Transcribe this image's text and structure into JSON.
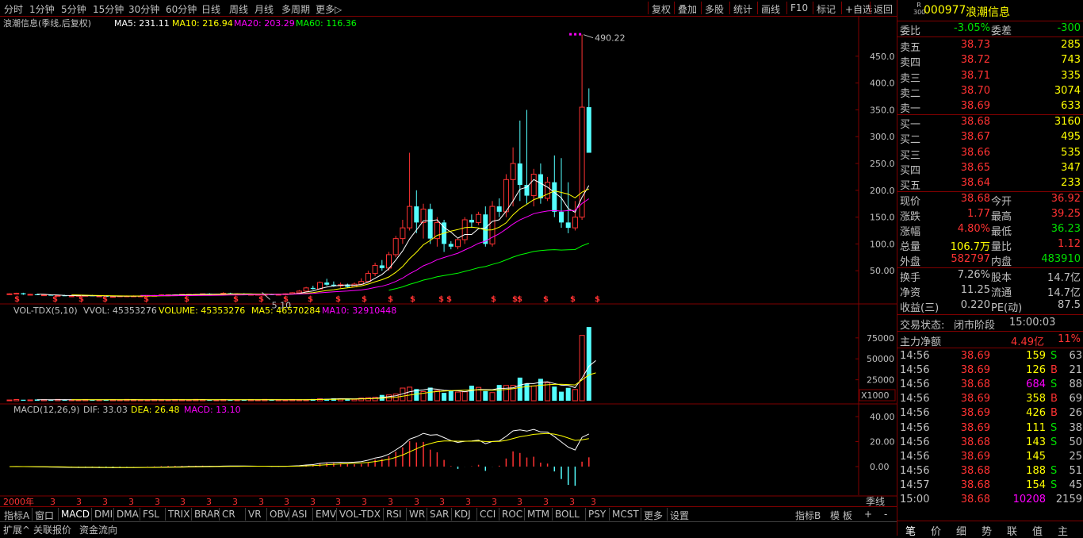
{
  "topbar": {
    "periods": [
      "分时",
      "1分钟",
      "5分钟",
      "15分钟",
      "30分钟",
      "60分钟",
      "日线",
      "周线",
      "月线",
      "多周期",
      "更多▷"
    ],
    "right_buttons": [
      "复权",
      "叠加",
      "多股",
      "统计",
      "画线",
      "F10",
      "标记",
      "+自选",
      "返回"
    ]
  },
  "main_chart": {
    "title": "浪潮信息(季线,后复权)",
    "ma5": "MA5: 231.11",
    "ma10": "MA10: 216.94",
    "ma20": "MA20: 203.29",
    "ma60": "MA60: 116.36",
    "high_label": "490.22",
    "low_label": "5.10",
    "y_ticks": [
      "450.0",
      "400.0",
      "350.0",
      "300.0",
      "250.0",
      "200.0",
      "150.0",
      "100.0",
      "50.00"
    ]
  },
  "volume_chart": {
    "title": "VOL-TDX(5,10)",
    "vvol": "VVOL: 45353276",
    "volume": "VOLUME: 45353276",
    "ma5": "MA5: 46570284",
    "ma10": "MA10: 32910448",
    "y_ticks": [
      "75000",
      "50000",
      "25000"
    ],
    "unit": "X1000"
  },
  "macd_chart": {
    "title": "MACD(12,26,9)",
    "dif": "DIF: 33.03",
    "dea": "DEA: 26.48",
    "macd": "MACD: 13.10",
    "y_ticks": [
      "40.00",
      "20.00",
      "0.00"
    ]
  },
  "date_axis": {
    "start_label": "2000年",
    "tick_label": "3",
    "period_label": "季线"
  },
  "bottom_tabs": [
    "指标A",
    "窗口",
    "MACD",
    "DMI",
    "DMA",
    "FSL",
    "TRIX",
    "BRAR",
    "CR",
    "VR",
    "OBV",
    "ASI",
    "EMV",
    "VOL-TDX",
    "RSI",
    "WR",
    "SAR",
    "KDJ",
    "CCI",
    "ROC",
    "MTM",
    "BOLL",
    "PSY",
    "MCST",
    "更多",
    "设置"
  ],
  "bottom_right": [
    "指标B",
    "模 板",
    "+",
    "-"
  ],
  "bottom_bar2": [
    "扩展^",
    "关联报价",
    "资金流向"
  ],
  "quote": {
    "badge_top": "R",
    "badge_bottom": "300",
    "code": "000977",
    "name": "浪潮信息",
    "weibi_label": "委比",
    "weibi": "-3.05%",
    "weicha_label": "委差",
    "weicha": "-300",
    "asks": [
      {
        "label": "卖五",
        "price": "38.73",
        "vol": "285"
      },
      {
        "label": "卖四",
        "price": "38.72",
        "vol": "743"
      },
      {
        "label": "卖三",
        "price": "38.71",
        "vol": "335"
      },
      {
        "label": "卖二",
        "price": "38.70",
        "vol": "3074"
      },
      {
        "label": "卖一",
        "price": "38.69",
        "vol": "633"
      }
    ],
    "bids": [
      {
        "label": "买一",
        "price": "38.68",
        "vol": "3160"
      },
      {
        "label": "买二",
        "price": "38.67",
        "vol": "495"
      },
      {
        "label": "买三",
        "price": "38.66",
        "vol": "535"
      },
      {
        "label": "买四",
        "price": "38.65",
        "vol": "347"
      },
      {
        "label": "买五",
        "price": "38.64",
        "vol": "233"
      }
    ],
    "stats": [
      {
        "l1": "现价",
        "v1": "38.68",
        "l2": "今开",
        "v2": "36.92"
      },
      {
        "l1": "涨跌",
        "v1": "1.77",
        "l2": "最高",
        "v2": "39.25"
      },
      {
        "l1": "涨幅",
        "v1": "4.80%",
        "l2": "最低",
        "v2": "36.23"
      },
      {
        "l1": "总量",
        "v1": "106.7万",
        "l2": "量比",
        "v2": "1.12"
      },
      {
        "l1": "外盘",
        "v1": "582797",
        "l2": "内盘",
        "v2": "483910"
      }
    ],
    "stats2": [
      {
        "l1": "换手",
        "v1": "7.26%",
        "l2": "股本",
        "v2": "14.7亿"
      },
      {
        "l1": "净资",
        "v1": "11.25",
        "l2": "流通",
        "v2": "14.7亿"
      },
      {
        "l1": "收益(三)",
        "v1": "0.220",
        "l2": "PE(动)",
        "v2": "87.5"
      }
    ],
    "trade_state_label": "交易状态:",
    "trade_state": "闭市阶段",
    "trade_time": "15:00:03",
    "main_net_label": "主力净额",
    "main_net": "4.49亿",
    "main_net_pct": "11%",
    "ticks": [
      {
        "t": "14:56",
        "p": "38.69",
        "v": "159",
        "bs": "S",
        "n": "63"
      },
      {
        "t": "14:56",
        "p": "38.69",
        "v": "126",
        "bs": "B",
        "n": "21"
      },
      {
        "t": "14:56",
        "p": "38.68",
        "v": "684",
        "bs": "S",
        "n": "88"
      },
      {
        "t": "14:56",
        "p": "38.69",
        "v": "358",
        "bs": "B",
        "n": "69"
      },
      {
        "t": "14:56",
        "p": "38.69",
        "v": "426",
        "bs": "B",
        "n": "26"
      },
      {
        "t": "14:56",
        "p": "38.69",
        "v": "111",
        "bs": "S",
        "n": "38"
      },
      {
        "t": "14:56",
        "p": "38.68",
        "v": "143",
        "bs": "S",
        "n": "50"
      },
      {
        "t": "14:56",
        "p": "38.69",
        "v": "145",
        "bs": "",
        "n": "25"
      },
      {
        "t": "14:56",
        "p": "38.68",
        "v": "188",
        "bs": "S",
        "n": "51"
      },
      {
        "t": "14:57",
        "p": "38.68",
        "v": "154",
        "bs": "S",
        "n": "45"
      },
      {
        "t": "15:00",
        "p": "38.68",
        "v": "10208",
        "bs": "",
        "n": "2159"
      }
    ],
    "bottom_tabs": [
      "笔",
      "价",
      "细",
      "势",
      "联",
      "值",
      "主"
    ]
  },
  "colors": {
    "up": "#ff3232",
    "down": "#54ffff",
    "ma5": "#ffffff",
    "ma10": "#ffff00",
    "ma20": "#ff00ff",
    "ma60": "#00ff00",
    "grid": "#800000",
    "axis_text": "#c0c0c0"
  },
  "chart_data": {
    "type": "candlestick",
    "title": "浪潮信息(季线,后复权)",
    "candles": [
      [
        7,
        8,
        6,
        7
      ],
      [
        7,
        9,
        6,
        8
      ],
      [
        8,
        9,
        5,
        6
      ],
      [
        6,
        7,
        5,
        6
      ],
      [
        6,
        7,
        5,
        5
      ],
      [
        5,
        6,
        4,
        5
      ],
      [
        5,
        6,
        4,
        4
      ],
      [
        4,
        5,
        3,
        4
      ],
      [
        4,
        5,
        3,
        3
      ],
      [
        3,
        4,
        3,
        3
      ],
      [
        3,
        5,
        3,
        4
      ],
      [
        4,
        5,
        3,
        4
      ],
      [
        4,
        5,
        3,
        3
      ],
      [
        3,
        4,
        2,
        3
      ],
      [
        3,
        4,
        2,
        2
      ],
      [
        2,
        3,
        2,
        2
      ],
      [
        2,
        3,
        2,
        3
      ],
      [
        3,
        4,
        2,
        3
      ],
      [
        3,
        4,
        2,
        3
      ],
      [
        3,
        4,
        3,
        3
      ],
      [
        3,
        4,
        3,
        4
      ],
      [
        4,
        5,
        3,
        4
      ],
      [
        4,
        6,
        4,
        5
      ],
      [
        5,
        6,
        4,
        5
      ],
      [
        5,
        6,
        4,
        5
      ],
      [
        5,
        6,
        4,
        6
      ],
      [
        6,
        7,
        5,
        6
      ],
      [
        6,
        7,
        5,
        6
      ],
      [
        6,
        7,
        5,
        7
      ],
      [
        7,
        8,
        5,
        6
      ],
      [
        6,
        7,
        5,
        6
      ],
      [
        6,
        10,
        5,
        8
      ],
      [
        8,
        9,
        6,
        7
      ],
      [
        7,
        8,
        6,
        7
      ],
      [
        7,
        8,
        5,
        6
      ],
      [
        6,
        7,
        5,
        6
      ],
      [
        6,
        7,
        5,
        6
      ],
      [
        6,
        7,
        5,
        6
      ],
      [
        6,
        7,
        5,
        5.1
      ],
      [
        5.1,
        7,
        5.1,
        6
      ],
      [
        6,
        8,
        6,
        7
      ],
      [
        7,
        10,
        7,
        9
      ],
      [
        9,
        14,
        8,
        12
      ],
      [
        12,
        20,
        11,
        18
      ],
      [
        18,
        22,
        15,
        16
      ],
      [
        16,
        30,
        15,
        28
      ],
      [
        28,
        35,
        22,
        24
      ],
      [
        24,
        30,
        20,
        22
      ],
      [
        22,
        28,
        18,
        24
      ],
      [
        24,
        26,
        18,
        20
      ],
      [
        20,
        28,
        19,
        25
      ],
      [
        25,
        36,
        24,
        30
      ],
      [
        30,
        50,
        28,
        45
      ],
      [
        45,
        65,
        40,
        60
      ],
      [
        60,
        70,
        50,
        55
      ],
      [
        55,
        85,
        50,
        80
      ],
      [
        80,
        115,
        75,
        110
      ],
      [
        110,
        145,
        100,
        130
      ],
      [
        130,
        270,
        125,
        170
      ],
      [
        170,
        200,
        120,
        140
      ],
      [
        140,
        175,
        110,
        165
      ],
      [
        165,
        175,
        100,
        110
      ],
      [
        110,
        150,
        95,
        140
      ],
      [
        140,
        145,
        85,
        100
      ],
      [
        100,
        105,
        90,
        95
      ],
      [
        95,
        110,
        90,
        108
      ],
      [
        108,
        150,
        100,
        145
      ],
      [
        145,
        155,
        130,
        140
      ],
      [
        140,
        160,
        135,
        155
      ],
      [
        155,
        170,
        95,
        100
      ],
      [
        100,
        180,
        95,
        170
      ],
      [
        170,
        185,
        150,
        160
      ],
      [
        160,
        230,
        150,
        220
      ],
      [
        220,
        280,
        170,
        250
      ],
      [
        250,
        330,
        180,
        210
      ],
      [
        210,
        350,
        175,
        190
      ],
      [
        190,
        240,
        170,
        230
      ],
      [
        230,
        250,
        175,
        185
      ],
      [
        185,
        225,
        180,
        215
      ],
      [
        215,
        265,
        150,
        160
      ],
      [
        160,
        260,
        130,
        140
      ],
      [
        140,
        215,
        120,
        130
      ],
      [
        130,
        180,
        125,
        150
      ],
      [
        150,
        490.22,
        145,
        355
      ],
      [
        355,
        390,
        270,
        270
      ]
    ],
    "ma60_start": [
      16,
      "index"
    ],
    "ylim": [
      0,
      500
    ]
  }
}
